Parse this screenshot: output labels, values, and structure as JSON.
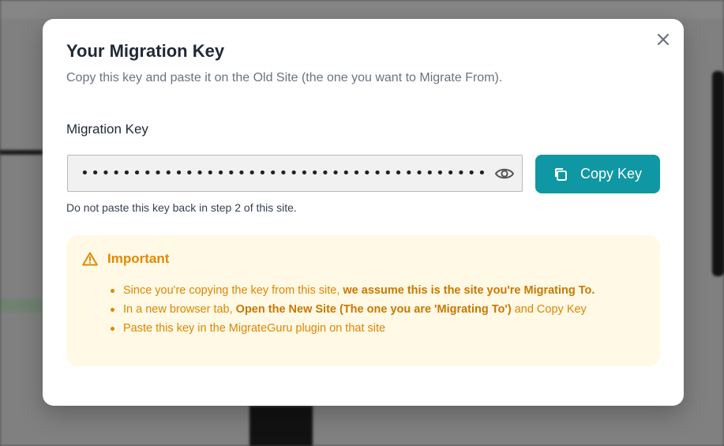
{
  "modal": {
    "title": "Your Migration Key",
    "subtitle": "Copy this key and paste it on the Old Site (the one you want to Migrate From).",
    "field_label": "Migration Key",
    "masked_key": "••••••••••••••••••••••••••••••••••••••••••",
    "copy_button_label": "Copy Key",
    "hint": "Do not paste this key back in step 2 of this site.",
    "important": {
      "heading": "Important",
      "items": [
        {
          "text": "Since you're copying the key from this site, ",
          "bold": "we assume this is the site you're Migrating To.",
          "after": ""
        },
        {
          "text": "In a new browser tab, ",
          "bold": "Open the New Site (The one you are 'Migrating To')",
          "after": " and Copy Key"
        },
        {
          "text": "Paste this key in the MigrateGuru plugin on that site",
          "bold": "",
          "after": ""
        }
      ]
    }
  },
  "icons": {
    "close": "close-icon",
    "reveal": "eye-icon",
    "copy": "copy-icon",
    "warning": "warning-icon"
  },
  "colors": {
    "accent": "#0f98a3",
    "warning": "#e08a00",
    "warning_bg": "#fff9e6"
  }
}
